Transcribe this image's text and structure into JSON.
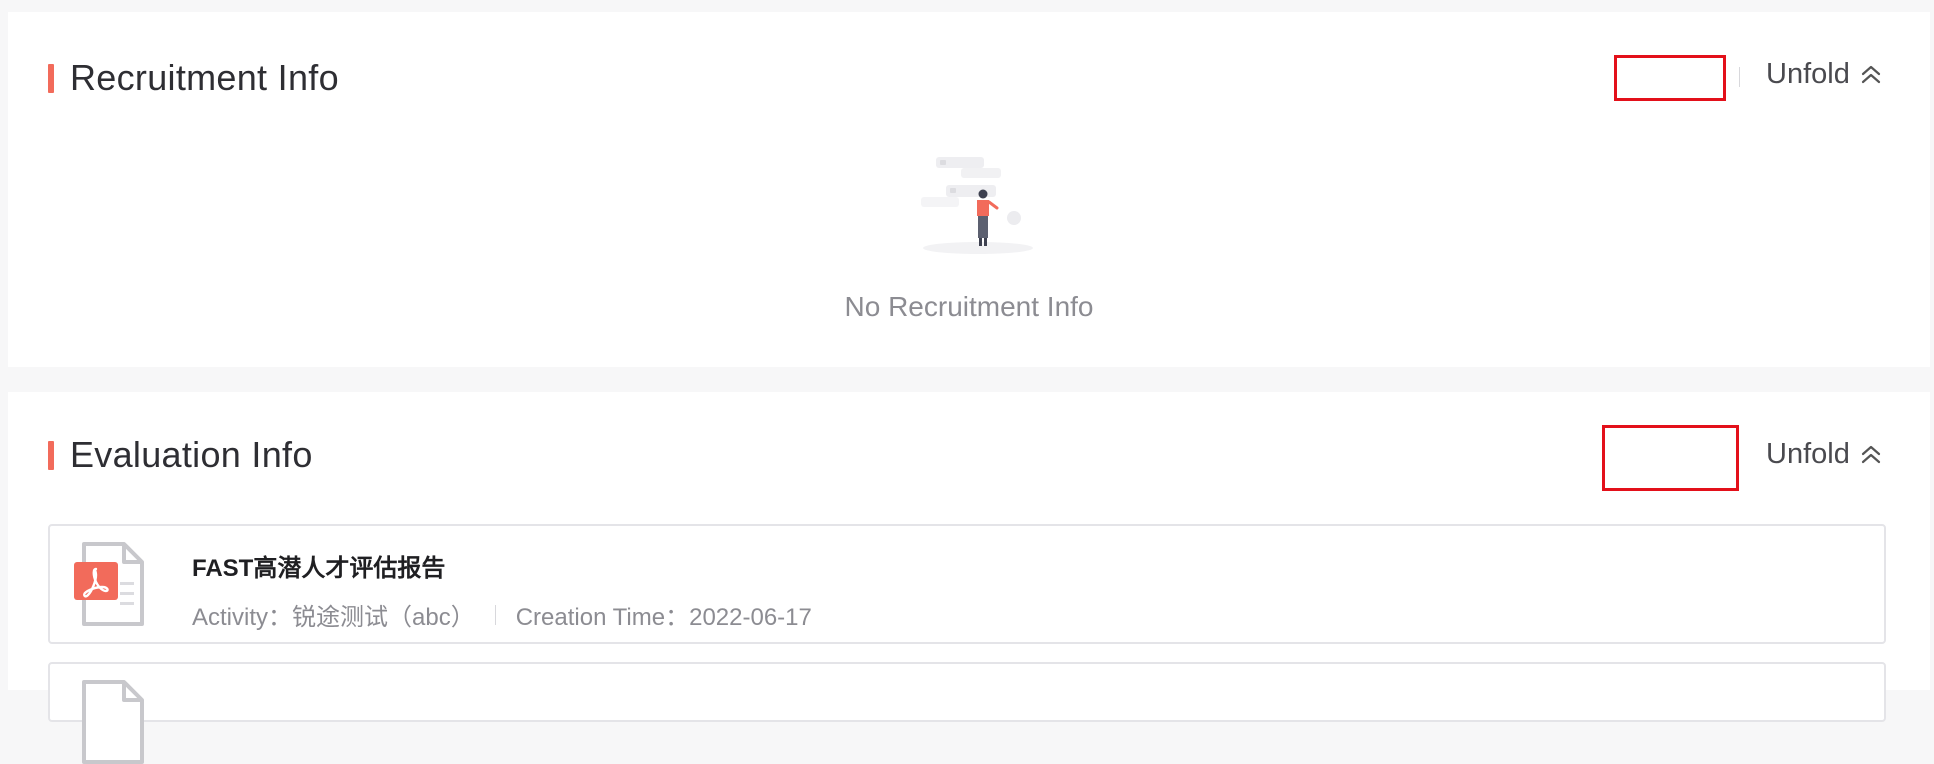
{
  "recruitment": {
    "title": "Recruitment Info",
    "unfold_label": "Unfold",
    "empty_text": "No Recruitment Info"
  },
  "evaluation": {
    "title": "Evaluation Info",
    "unfold_label": "Unfold",
    "reports": [
      {
        "title": "FAST高潜人才评估报告",
        "activity": "Activity：锐途测试（abc）",
        "creation_time": "Creation Time：2022-06-17"
      }
    ]
  },
  "colors": {
    "accent": "#f26b5b",
    "highlight_box": "#e3101a",
    "pdf_red": "#f26b5b",
    "muted_text": "#8c8c92"
  },
  "icons": {
    "unfold": "double-chevron-up-icon",
    "empty": "empty-state-illustration",
    "report": "pdf-file-icon"
  }
}
